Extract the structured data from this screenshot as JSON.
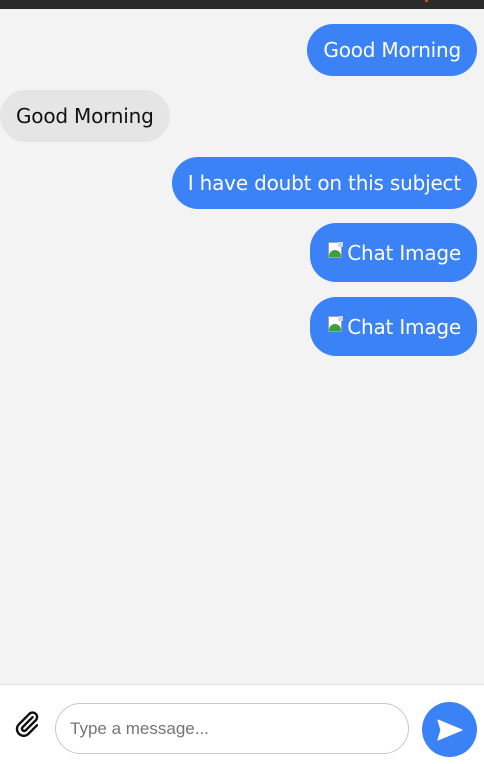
{
  "colors": {
    "sent_bubble": "#3b82f6",
    "received_bubble": "#e5e5e5",
    "background": "#f3f3f3",
    "send_button": "#3b82f6"
  },
  "messages": [
    {
      "type": "sent",
      "text": "Good Morning"
    },
    {
      "type": "received",
      "text": "Good Morning"
    },
    {
      "type": "sent",
      "text": "I have doubt on this subject"
    },
    {
      "type": "sent-image",
      "alt": "Chat Image",
      "icon": "broken-image-icon"
    },
    {
      "type": "sent-image",
      "alt": "Chat Image",
      "icon": "broken-image-icon"
    }
  ],
  "composer": {
    "attach_icon": "paperclip-icon",
    "placeholder": "Type a message...",
    "value": "",
    "send_icon": "send-icon"
  }
}
